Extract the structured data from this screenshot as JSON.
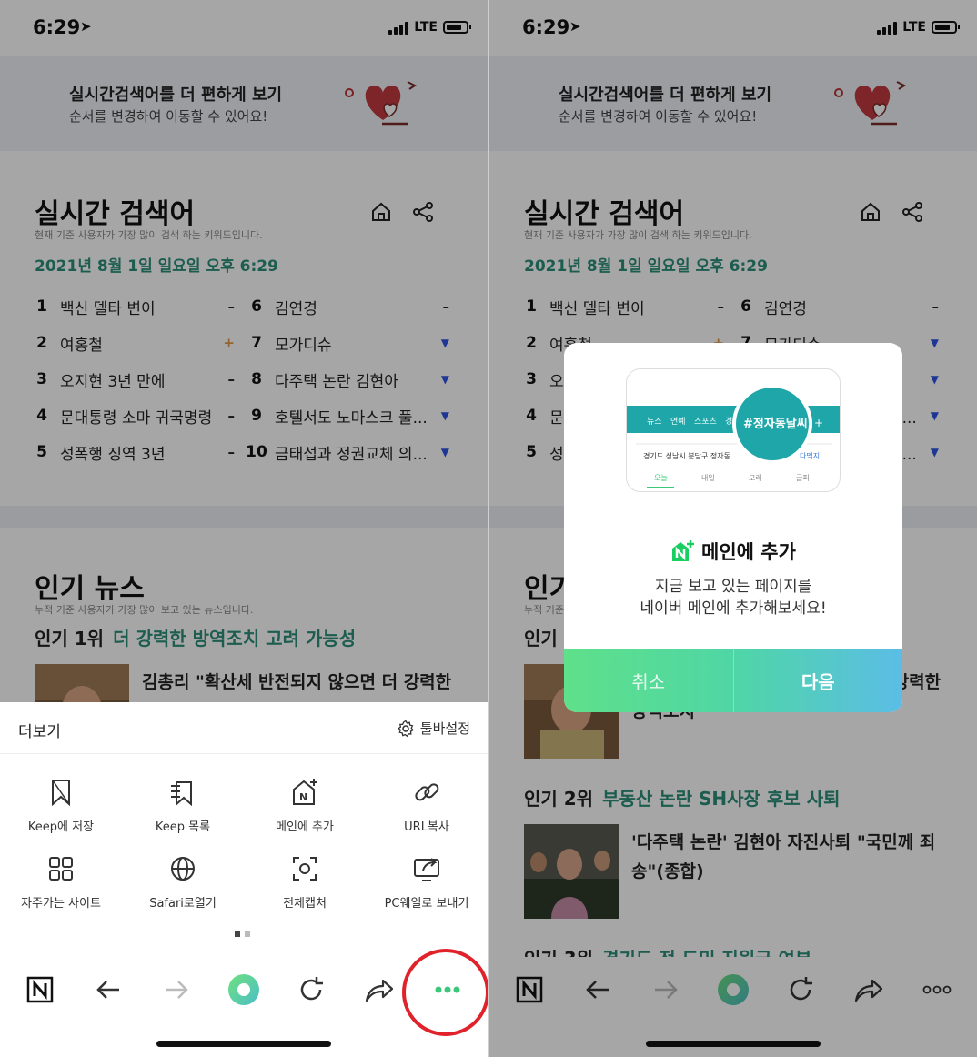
{
  "status": {
    "time": "6:29",
    "network": "LTE"
  },
  "banner": {
    "title": "실시간검색어를 더 편하게 보기",
    "subtitle": "순서를 변경하여 이동할 수 있어요!"
  },
  "realtime": {
    "title": "실시간 검색어",
    "subtitle": "현재 기준 사용자가 가장 많이 검색 하는 키워드입니다.",
    "date": "2021년 8월 1일 일요일 오후 6:29",
    "items": [
      {
        "rank": "1",
        "text": "백신 델타 변이",
        "trend": "–"
      },
      {
        "rank": "2",
        "text": "여홍철",
        "trend": "+"
      },
      {
        "rank": "3",
        "text": "오지현 3년 만에",
        "trend": "–"
      },
      {
        "rank": "4",
        "text": "문대통령 소마 귀국명령",
        "trend": "–"
      },
      {
        "rank": "5",
        "text": "성폭행 징역 3년",
        "trend": "–"
      },
      {
        "rank": "6",
        "text": "김연경",
        "trend": "–"
      },
      {
        "rank": "7",
        "text": "모가디슈",
        "trend": "▼"
      },
      {
        "rank": "8",
        "text": "다주택 논란 김현아",
        "trend": "▼"
      },
      {
        "rank": "9",
        "text": "호텔서도 노마스크 풀...",
        "trend": "▼"
      },
      {
        "rank": "10",
        "text": "금태섭과 정권교체 의...",
        "trend": "▼"
      }
    ]
  },
  "news": {
    "title": "인기 뉴스",
    "subtitle": "누적 기준 사용자가 가장 많이 보고 있는 뉴스입니다.",
    "rank1": {
      "label": "인기 1위",
      "topic": "더 강력한 방역조치 고려 가능성",
      "headline": "김총리 \"확산세 반전되지 않으면 더 강력한",
      "headline_tail": "강력한",
      "headline2": "방역조치\""
    },
    "rank2": {
      "label": "인기 2위",
      "topic": "부동산 논란 SH사장 후보 사퇴",
      "headline": "'다주택 논란' 김현아 자진사퇴 \"국민께 죄송\"(종합)"
    },
    "rank3": {
      "label": "인기 3위",
      "topic": "경기도 전 도민 지원금 여부"
    }
  },
  "more_sheet": {
    "title": "더보기",
    "toolbar_settings": "툴바설정",
    "items": [
      {
        "label": "Keep에 저장",
        "icon": "bookmark-icon"
      },
      {
        "label": "Keep 목록",
        "icon": "keep-list-icon"
      },
      {
        "label": "메인에 추가",
        "icon": "add-to-main-icon"
      },
      {
        "label": "URL복사",
        "icon": "link-icon"
      },
      {
        "label": "자주가는 사이트",
        "icon": "grid-icon"
      },
      {
        "label": "Safari로열기",
        "icon": "globe-icon"
      },
      {
        "label": "전체캡처",
        "icon": "capture-icon"
      },
      {
        "label": "PC웨일로 보내기",
        "icon": "send-to-pc-icon"
      }
    ]
  },
  "dialog": {
    "preview": {
      "tabs": [
        "뉴스",
        "연예",
        "스포츠",
        "경"
      ],
      "tag": "#정자동날씨",
      "address": "경기도 성남시 분당구 정자동",
      "days": [
        "오늘",
        "내일",
        "모레",
        "글피"
      ],
      "more": "다먹지"
    },
    "title": "메인에 추가",
    "line1": "지금 보고 있는 페이지를",
    "line2": "네이버 메인에 추가해보세요!",
    "cancel": "취소",
    "next": "다음"
  },
  "colors": {
    "accent_green": "#2c8f7a",
    "highlight_red": "#e0232a",
    "trend_down": "#2f55e4",
    "trend_up": "#e29a4b"
  }
}
